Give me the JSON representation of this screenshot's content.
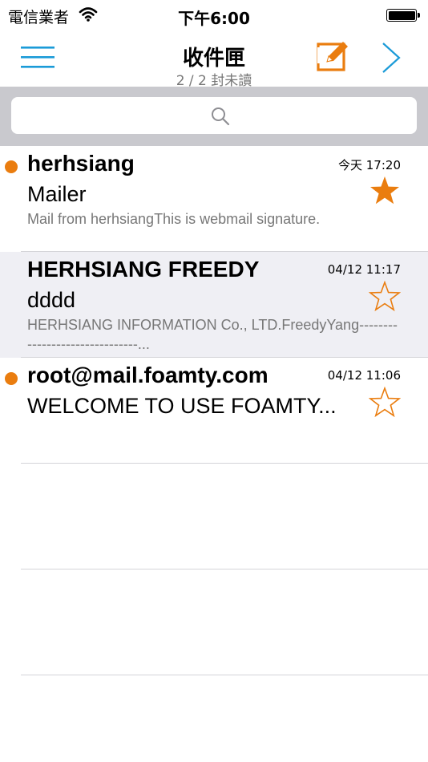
{
  "status_bar": {
    "carrier": "電信業者",
    "time": "下午6:00",
    "wifi_icon": "wifi-icon",
    "battery_icon": "battery-full-icon"
  },
  "nav": {
    "title": "收件匣",
    "subtitle": "2 / 2 封未讀",
    "menu_icon": "hamburger-menu-icon",
    "compose_icon": "compose-icon",
    "forward_icon": "chevron-right-icon"
  },
  "search": {
    "placeholder": "",
    "value": "",
    "icon": "search-icon"
  },
  "colors": {
    "accent_blue": "#1b9bd8",
    "accent_orange": "#ea7d0f",
    "search_bg": "#c9c9ce",
    "selected_row_bg": "#efeff4"
  },
  "mails": [
    {
      "sender": "herhsiang",
      "time": "今天 17:20",
      "subject": "Mailer",
      "preview": "Mail from herhsiangThis is webmail signature.",
      "unread": true,
      "starred": true
    },
    {
      "sender": "HERHSIANG FREEDY",
      "time": "04/12 11:17",
      "subject": "dddd",
      "preview": "HERHSIANG INFORMATION Co., LTD.FreedyYang-------------------------------...",
      "unread": false,
      "starred": false
    },
    {
      "sender": "root@mail.foamty.com",
      "time": "04/12 11:06",
      "subject": "WELCOME TO USE FOAMTY...",
      "preview": "",
      "unread": true,
      "starred": false
    }
  ]
}
